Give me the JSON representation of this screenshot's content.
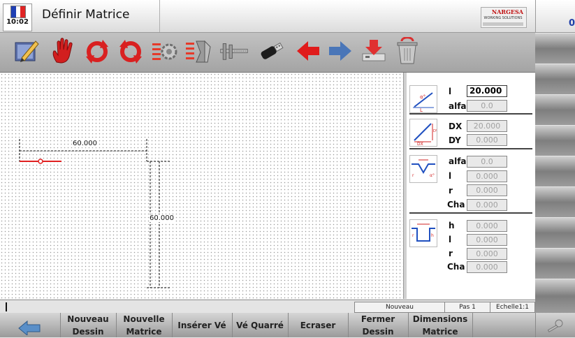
{
  "header": {
    "time": "10:02",
    "title": "Définir Matrice",
    "counter": "0"
  },
  "logo": {
    "brand": "NARGESA",
    "tagline": "WORKING SOLUTIONS"
  },
  "colors": {
    "arrow_red": "#e01b1b",
    "arrow_blue": "#4a76b8",
    "flag_blue": "#1f3fb3",
    "flag_red": "#e02424"
  },
  "toolbar": {
    "icons": [
      "pencil-icon",
      "hand-icon",
      "rotate-cw-icon",
      "rotate-ccw-icon",
      "gear-list-icon",
      "list-tools-icon",
      "caliper-icon",
      "usb-key-icon",
      "arrow-left-icon",
      "arrow-right-icon",
      "install-icon",
      "trash-icon"
    ]
  },
  "canvas": {
    "dim_horizontal": "60.000",
    "dim_vertical": "60.000"
  },
  "params": {
    "line": {
      "l_label": "l",
      "l_value": "20.000",
      "alfa_label": "alfa",
      "alfa_value": "0.0"
    },
    "dxdy": {
      "dx_label": "DX",
      "dx_value": "20.000",
      "dy_label": "DY",
      "dy_value": "0.000"
    },
    "vee": {
      "alfa_label": "alfa",
      "alfa_value": "0.0",
      "l_label": "l",
      "l_value": "0.000",
      "r_label": "r",
      "r_value": "0.000",
      "cha_label": "Cha",
      "cha_value": "0.000"
    },
    "square": {
      "h_label": "h",
      "h_value": "0.000",
      "l_label": "l",
      "l_value": "0.000",
      "r_label": "r",
      "r_value": "0.000",
      "cha_label": "Cha",
      "cha_value": "0.000"
    },
    "pic_labels": {
      "alpha": "α°",
      "l": "L",
      "dy": "DY",
      "dx": "DX",
      "h": "h",
      "r": "r"
    }
  },
  "status": {
    "mode": "Nouveau",
    "step": "Pas 1",
    "scale": "Echelle1:1"
  },
  "fbar": {
    "nouveau_dessin": [
      "Nouveau",
      "Dessin"
    ],
    "nouvelle_matrice": [
      "Nouvelle",
      "Matrice"
    ],
    "inserer_ve": "Insérer Vé",
    "ve_quarre": "Vé Quarré",
    "ecraser": "Ecraser",
    "fermer_dessin": [
      "Fermer",
      "Dessin"
    ],
    "dimensions_matrice": [
      "Dimensions",
      "Matrice"
    ]
  }
}
